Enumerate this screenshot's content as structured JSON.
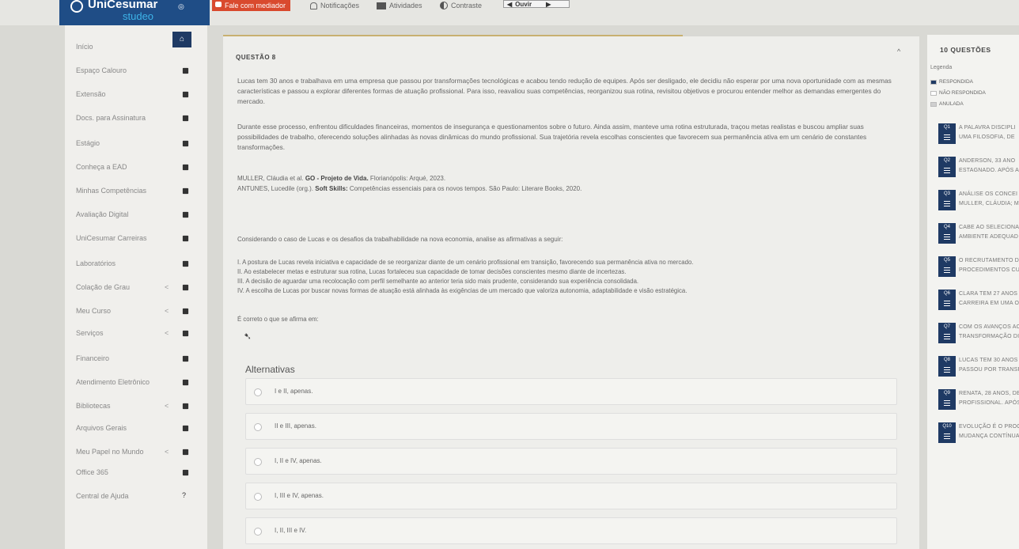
{
  "topbar": {
    "brand_name": "UniCesumar",
    "brand_sub": "studeo",
    "mediador": "Fale com mediador",
    "notificacoes": "Notificações",
    "atividades": "Atividades",
    "contraste": "Contraste",
    "ouvir": "Ouvir"
  },
  "sidebar": {
    "items": [
      {
        "label": "Início",
        "icon": "home-icon"
      },
      {
        "label": "Espaço Calouro",
        "icon": "pencil-icon"
      },
      {
        "label": "Extensão",
        "icon": "calendar-icon"
      },
      {
        "label": "Docs. para Assinatura",
        "icon": "document-icon"
      },
      {
        "label": "Estágio",
        "icon": "graduation-cap-icon"
      },
      {
        "label": "Conheça a EAD",
        "icon": "puzzle-icon"
      },
      {
        "label": "Minhas Competências",
        "icon": "puzzle-icon"
      },
      {
        "label": "Avaliação Digital",
        "icon": "calendar-icon"
      },
      {
        "label": "UniCesumar Carreiras",
        "icon": "briefcase-icon"
      },
      {
        "label": "Laboratórios",
        "icon": "eyedropper-icon"
      },
      {
        "label": "Colação de Grau",
        "icon": "graduation-cap-icon"
      },
      {
        "label": "Meu Curso",
        "icon": "graduation-cap-icon"
      },
      {
        "label": "Serviços",
        "icon": "building-icon"
      },
      {
        "label": "Financeiro",
        "icon": "dollar-icon"
      },
      {
        "label": "Atendimento Eletrônico",
        "icon": "puzzle-icon"
      },
      {
        "label": "Bibliotecas",
        "icon": "book-icon"
      },
      {
        "label": "Arquivos Gerais",
        "icon": "folder-icon"
      },
      {
        "label": "Meu Papel no Mundo",
        "icon": "globe-icon"
      },
      {
        "label": "Office 365",
        "icon": "windows-icon"
      },
      {
        "label": "Central de Ajuda",
        "icon": "question-icon",
        "glyph": "?"
      }
    ],
    "chevron": "<"
  },
  "question": {
    "title": "QUESTÃO 8",
    "paragraph1": "Lucas tem 30 anos e trabalhava em uma empresa que passou por transformações tecnológicas e acabou tendo redução de equipes. Após ser desligado, ele decidiu não esperar por uma nova oportunidade com as mesmas características e passou a explorar diferentes formas de atuação profissional. Para isso, reavaliou suas competências, reorganizou sua rotina, revisitou objetivos e procurou entender melhor as demandas emergentes do mercado.",
    "paragraph2": "Durante esse processo, enfrentou dificuldades financeiras, momentos de insegurança e questionamentos sobre o futuro. Ainda assim, manteve uma rotina estruturada, traçou metas realistas e buscou ampliar suas possibilidades de trabalho, oferecendo soluções alinhadas às novas dinâmicas do mundo profissional. Sua trajetória revela escolhas conscientes que favorecem sua permanência ativa em um cenário de constantes transformações.",
    "ref1_pre": "MULLER, Cláudia et al. ",
    "ref1_bold": "GO - Projeto de Vida.",
    "ref1_post": " Florianópolis: Arqué, 2023.",
    "ref2_pre": "ANTUNES, Lucedile (org.). ",
    "ref2_bold": "Soft Skills:",
    "ref2_post": " Competências essenciais para os novos tempos. São Paulo: Literare Books, 2020.",
    "prompt": "Considerando o caso de Lucas e os desafios da trabalhabilidade na nova economia, analise as afirmativas a seguir:",
    "statements": [
      "I. A postura de Lucas revela iniciativa e capacidade de se reorganizar diante de um cenário profissional em transição, favorecendo sua permanência ativa no mercado.",
      "II. Ao estabelecer metas e estruturar sua rotina, Lucas fortaleceu sua capacidade de tomar decisões conscientes mesmo diante de incertezas.",
      "III. A decisão de aguardar uma recolocação com perfil semelhante ao anterior teria sido mais prudente, considerando sua experiência consolidada.",
      "IV. A escolha de Lucas por buscar novas formas de atuação está alinhada às exigências de um mercado que valoriza autonomia, adaptabilidade e visão estratégica."
    ],
    "ask": "É correto o que se afirma em:",
    "alternatives_title": "Alternativas",
    "alternatives": [
      "I e II, apenas.",
      "II e III, apenas.",
      "I, II e IV, apenas.",
      "I, III e IV, apenas.",
      "I, II, III e IV."
    ]
  },
  "right_panel": {
    "title": "10 QUESTÕES",
    "legend_title": "Legenda",
    "legend": [
      {
        "label": "RESPONDIDA",
        "color": "#1f3a64"
      },
      {
        "label": "NÃO RESPONDIDA",
        "color": "#ffffff"
      },
      {
        "label": "ANULADA",
        "color": "#cfcfcf"
      }
    ],
    "questions": [
      {
        "num": "Q1",
        "line1": "A PALAVRA DISCIPLI",
        "line2": "UMA FILOSOFIA, DE"
      },
      {
        "num": "Q2",
        "line1": "ANDERSON, 33 ANO",
        "line2": "ESTAGNADO. APÓS A"
      },
      {
        "num": "Q3",
        "line1": "ANÁLISE OS CONCEI",
        "line2": "MULLER, CLÁUDIA; M"
      },
      {
        "num": "Q4",
        "line1": "CABE AO SELECIONAI",
        "line2": "AMBIENTE ADEQUAD"
      },
      {
        "num": "Q5",
        "line1": "O RECRUTAMENTO D",
        "line2": "PROCEDIMENTOS CU"
      },
      {
        "num": "Q6",
        "line1": "CLARA TEM 27 ANOS",
        "line2": "CARREIRA EM UMA O"
      },
      {
        "num": "Q7",
        "line1": "COM OS AVANÇOS AC",
        "line2": "TRANSFORMAÇÃO DI"
      },
      {
        "num": "Q8",
        "line1": "LUCAS TEM 30 ANOS",
        "line2": "PASSOU POR TRANSFO"
      },
      {
        "num": "Q9",
        "line1": "RENATA, 28 ANOS, DE",
        "line2": "PROFISSIONAL. APÓS P"
      },
      {
        "num": "Q10",
        "line1": "EVOLUÇÃO É O PROCE",
        "line2": "MUDANÇA CONTÍNUA,"
      }
    ]
  }
}
